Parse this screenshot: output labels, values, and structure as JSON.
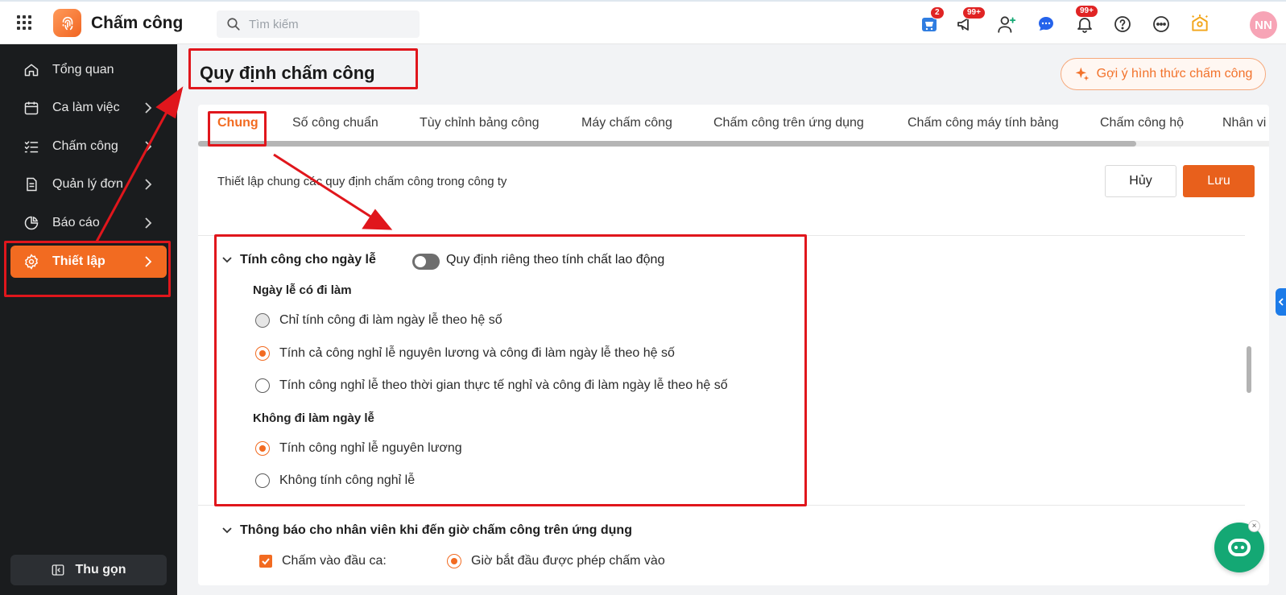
{
  "header": {
    "app_title": "Chấm công",
    "search_placeholder": "Tìm kiếm",
    "badges": {
      "cart": "2",
      "megaphone": "99+",
      "bell": "99+"
    },
    "avatar_initials": "NN"
  },
  "sidebar": {
    "items": [
      {
        "label": "Tổng quan",
        "icon": "home-icon"
      },
      {
        "label": "Ca làm việc",
        "icon": "calendar-icon"
      },
      {
        "label": "Chấm công",
        "icon": "checklist-icon"
      },
      {
        "label": "Quản lý đơn",
        "icon": "document-icon"
      },
      {
        "label": "Báo cáo",
        "icon": "pie-chart-icon"
      },
      {
        "label": "Thiết lập",
        "icon": "gear-icon"
      }
    ],
    "active_index": 5,
    "collapse_label": "Thu gọn"
  },
  "page": {
    "title": "Quy định chấm công",
    "suggest_label": "Gợi ý hình thức chấm công",
    "tabs": [
      "Chung",
      "Số công chuẩn",
      "Tùy chỉnh bảng công",
      "Máy chấm công",
      "Chấm công trên ứng dụng",
      "Chấm công máy tính bảng",
      "Chấm công hộ",
      "Nhân vi"
    ],
    "active_tab": 0,
    "description": "Thiết lập chung các quy định chấm công trong công ty",
    "cancel_label": "Hủy",
    "save_label": "Lưu"
  },
  "holiday_section": {
    "title": "Tính công cho ngày lễ",
    "toggle_label": "Quy định riêng theo tính chất lao động",
    "toggle_on": false,
    "working_group": {
      "title": "Ngày lễ có đi làm",
      "options": [
        "Chỉ tính công đi làm ngày lễ theo hệ số",
        "Tính cả công nghỉ lễ nguyên lương và công đi làm ngày lễ theo hệ số",
        "Tính công nghỉ lễ theo thời gian thực tế nghỉ và công đi làm ngày lễ theo hệ số"
      ],
      "selected": 1
    },
    "not_working_group": {
      "title": "Không đi làm ngày lễ",
      "options": [
        "Tính công nghỉ lễ nguyên lương",
        "Không tính công nghỉ lễ"
      ],
      "selected": 0
    }
  },
  "notify_section": {
    "title": "Thông báo cho nhân viên khi đến giờ chấm công trên ứng dụng",
    "checkbox_label": "Chấm vào đầu ca:",
    "radio_label": "Giờ bắt đầu được phép chấm vào"
  },
  "colors": {
    "accent": "#f26b21",
    "sidebar_bg": "#1a1c1e",
    "annotation": "#e0161c",
    "chat": "#14a874"
  }
}
